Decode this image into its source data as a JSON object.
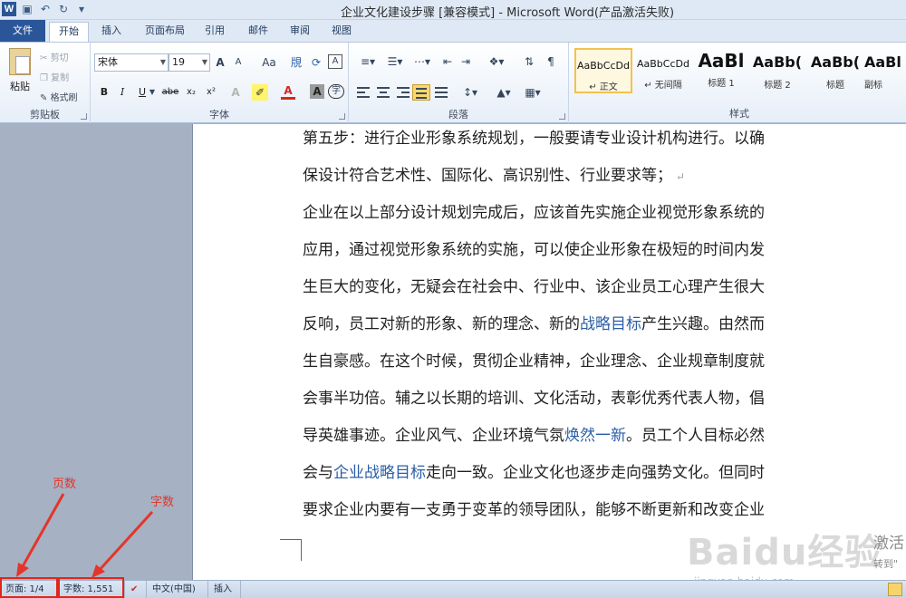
{
  "window": {
    "title": "企业文化建设步骤 [兼容模式] - Microsoft Word(产品激活失败)",
    "logo": "W"
  },
  "quick_access": {
    "save_icon": "save-icon",
    "undo_icon": "undo-icon",
    "redo_icon": "redo-icon",
    "customize_icon": "chevron-down-icon"
  },
  "tabs": [
    "文件",
    "开始",
    "插入",
    "页面布局",
    "引用",
    "邮件",
    "审阅",
    "视图"
  ],
  "clipboard": {
    "paste": "粘贴",
    "cut": "剪切",
    "copy": "复制",
    "format_painter": "格式刷",
    "label": "剪贴板"
  },
  "font": {
    "family": "宋体",
    "size": "19",
    "grow": "A",
    "shrink": "A",
    "case": "Aa",
    "bold": "B",
    "italic": "I",
    "underline": "U",
    "strike": "abe",
    "subscript": "x₂",
    "superscript": "x²",
    "label": "字体"
  },
  "paragraph": {
    "label": "段落"
  },
  "styles": {
    "label": "样式",
    "items": [
      {
        "sample": "AaBbCcDd",
        "name": "↵ 正文"
      },
      {
        "sample": "AaBbCcDd",
        "name": "↵ 无间隔"
      },
      {
        "sample": "AaBl",
        "name": "标题 1"
      },
      {
        "sample": "AaBb(",
        "name": "标题 2"
      },
      {
        "sample": "AaBb(",
        "name": "标题"
      },
      {
        "sample": "AaBl",
        "name": "副标"
      }
    ]
  },
  "document": {
    "lines": [
      [
        {
          "t": "第五步：进行企业形象系统规划，一般要请专业设计机构进行。以确"
        }
      ],
      [
        {
          "t": "保设计符合艺术性、国际化、高识别性、行业要求等；"
        },
        {
          "t": " ↵",
          "mark": true
        }
      ],
      [
        {
          "t": "企业在以上部分设计规划完成后，应该首先实施企业视觉形象系统的"
        }
      ],
      [
        {
          "t": "应用，通过视觉形象系统的实施，可以使企业形象在极短的时间内发"
        }
      ],
      [
        {
          "t": "生巨大的变化，无疑会在社会中、行业中、该企业员工心理产生很大"
        }
      ],
      [
        {
          "t": "反响，员工对新的形象、新的理念、新的"
        },
        {
          "t": "战略目标",
          "link": true
        },
        {
          "t": "产生兴趣。由然而"
        }
      ],
      [
        {
          "t": "生自豪感。在这个时候，贯彻企业精神，企业理念、企业规章制度就"
        }
      ],
      [
        {
          "t": "会事半功倍。辅之以长期的培训、文化活动，表彰优秀代表人物，倡"
        }
      ],
      [
        {
          "t": "导英雄事迹。企业风气、企业环境气氛"
        },
        {
          "t": "焕然一新",
          "link": true
        },
        {
          "t": "。员工个人目标必然"
        }
      ],
      [
        {
          "t": "会与"
        },
        {
          "t": "企业战略目标",
          "link": true
        },
        {
          "t": "走向一致。企业文化也逐步走向强势文化。但同时"
        }
      ],
      [
        {
          "t": "要求企业内要有一支勇于变革的领导团队，能够不断更新和改变企业"
        }
      ]
    ]
  },
  "watermark": {
    "main": "Baidu经验",
    "sub": "jingyan.baidu.com"
  },
  "activation": {
    "line1": "激活",
    "line2": "转到\""
  },
  "annotations": {
    "pages": "页数",
    "words": "字数"
  },
  "status": {
    "page": "页面: 1/4",
    "words": "字数: 1,551",
    "language": "中文(中国)",
    "mode": "插入"
  },
  "colors": {
    "file_tab": "#2a5699",
    "annotation": "#e2362b",
    "link": "#2a5ea8"
  }
}
